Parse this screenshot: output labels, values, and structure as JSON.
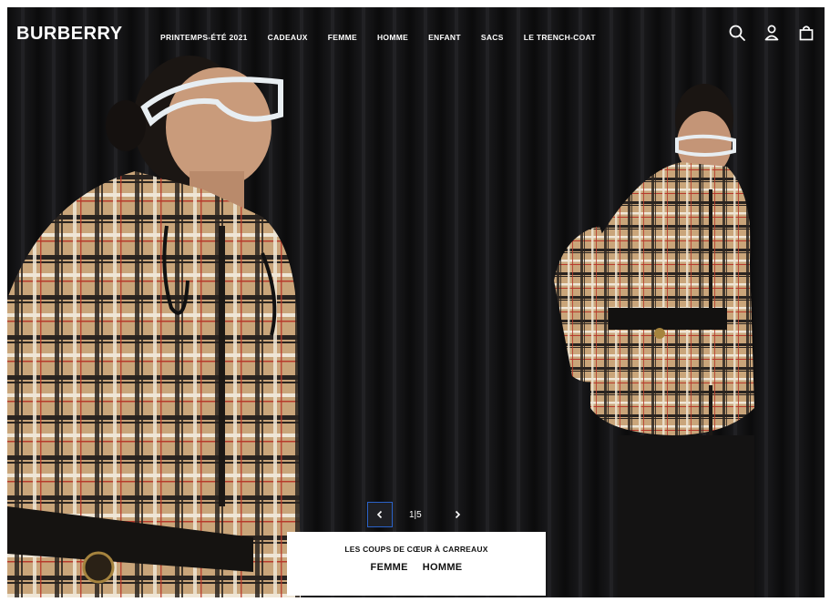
{
  "brand": {
    "logo_text": "BURBERRY"
  },
  "nav": {
    "items": [
      {
        "label": "PRINTEMPS-ÉTÉ 2021"
      },
      {
        "label": "CADEAUX"
      },
      {
        "label": "FEMME"
      },
      {
        "label": "HOMME"
      },
      {
        "label": "ENFANT"
      },
      {
        "label": "SACS"
      },
      {
        "label": "LE TRENCH-COAT"
      }
    ]
  },
  "header_icons": [
    "search-icon",
    "account-icon",
    "shopping-bag-icon"
  ],
  "carousel": {
    "counter": "1|5",
    "current": 1,
    "total": 5
  },
  "promo": {
    "title": "LES COUPS DE CŒUR À CARREAUX",
    "links": [
      {
        "label": "FEMME"
      },
      {
        "label": "HOMME"
      }
    ]
  },
  "colors": {
    "background": "#0d0d0e",
    "text_on_dark": "#ffffff",
    "accent_focus": "#2a62c9",
    "check_beige": "#c9a57a"
  }
}
